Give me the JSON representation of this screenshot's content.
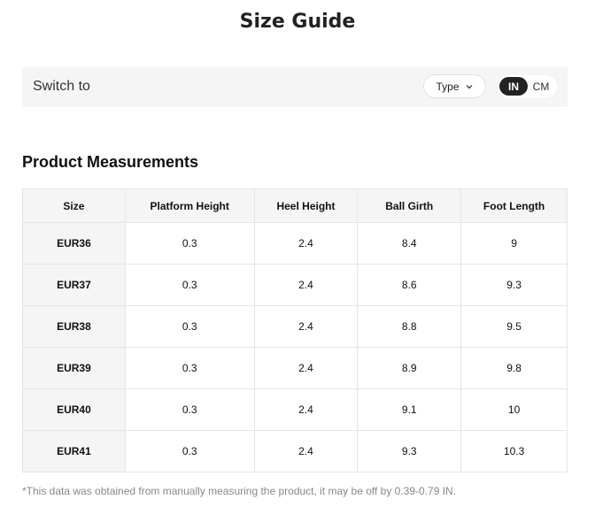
{
  "title": "Size Guide",
  "switch": {
    "label": "Switch to",
    "type_label": "Type",
    "unit_in": "IN",
    "unit_cm": "CM",
    "selected_unit": "IN"
  },
  "section_title": "Product Measurements",
  "table": {
    "headers": [
      "Size",
      "Platform Height",
      "Heel Height",
      "Ball Girth",
      "Foot Length"
    ],
    "rows": [
      [
        "EUR36",
        "0.3",
        "2.4",
        "8.4",
        "9"
      ],
      [
        "EUR37",
        "0.3",
        "2.4",
        "8.6",
        "9.3"
      ],
      [
        "EUR38",
        "0.3",
        "2.4",
        "8.8",
        "9.5"
      ],
      [
        "EUR39",
        "0.3",
        "2.4",
        "8.9",
        "9.8"
      ],
      [
        "EUR40",
        "0.3",
        "2.4",
        "9.1",
        "10"
      ],
      [
        "EUR41",
        "0.3",
        "2.4",
        "9.3",
        "10.3"
      ]
    ]
  },
  "footnote": "*This data was obtained from manually measuring the product, it may be off by 0.39-0.79 IN.",
  "icons": {
    "type_dropdown": "chevron-down-icon"
  }
}
